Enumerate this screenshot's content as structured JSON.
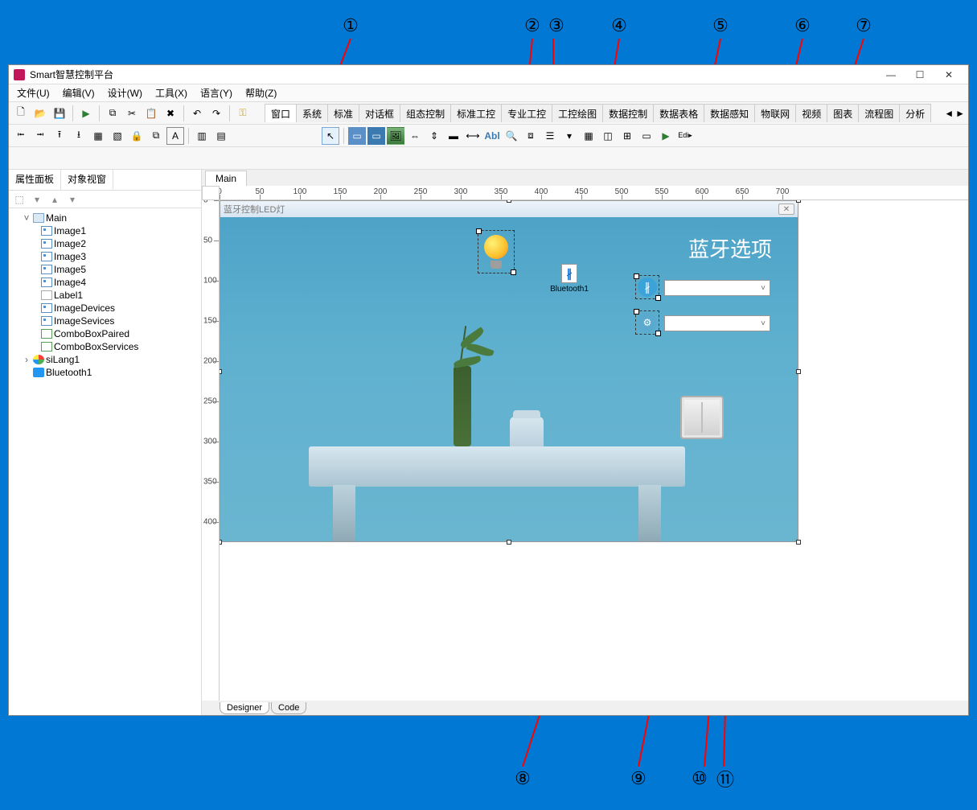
{
  "titlebar": {
    "title": "Smart智慧控制平台"
  },
  "menu": {
    "file": "文件(U)",
    "edit": "编辑(V)",
    "design": "设计(W)",
    "tools": "工具(X)",
    "lang": "语言(Y)",
    "help": "帮助(Z)"
  },
  "component_tabs": [
    "窗口",
    "系统",
    "标准",
    "对话框",
    "组态控制",
    "标准工控",
    "专业工控",
    "工控绘图",
    "数据控制",
    "数据表格",
    "数据感知",
    "物联网",
    "视频",
    "图表",
    "流程图",
    "分析"
  ],
  "left_panel": {
    "tabs": {
      "prop": "属性面板",
      "obj": "对象视窗"
    },
    "tree": {
      "root": "Main",
      "children": [
        "Image1",
        "Image2",
        "Image3",
        "Image5",
        "Image4",
        "Label1",
        "ImageDevices",
        "ImageSevices",
        "ComboBoxPaired",
        "ComboBoxServices"
      ],
      "siblings": [
        "siLang1",
        "Bluetooth1"
      ]
    }
  },
  "form_tab": "Main",
  "ruler_h": [
    "0",
    "50",
    "100",
    "150",
    "200",
    "250",
    "300",
    "350",
    "400",
    "450",
    "500",
    "550",
    "600",
    "650",
    "700"
  ],
  "ruler_v": [
    "0",
    "50",
    "100",
    "150",
    "200",
    "250",
    "300",
    "350",
    "400"
  ],
  "design_form": {
    "title": "蓝牙控制LED灯",
    "bluetooth_label": "Bluetooth1",
    "options_label": "蓝牙选项"
  },
  "bottom_tabs": {
    "designer": "Designer",
    "code": "Code"
  },
  "annotations": {
    "top": [
      "①",
      "②",
      "③",
      "④",
      "⑤",
      "⑥",
      "⑦"
    ],
    "bottom": [
      "⑧",
      "⑨",
      "⑩",
      "⑪"
    ]
  }
}
